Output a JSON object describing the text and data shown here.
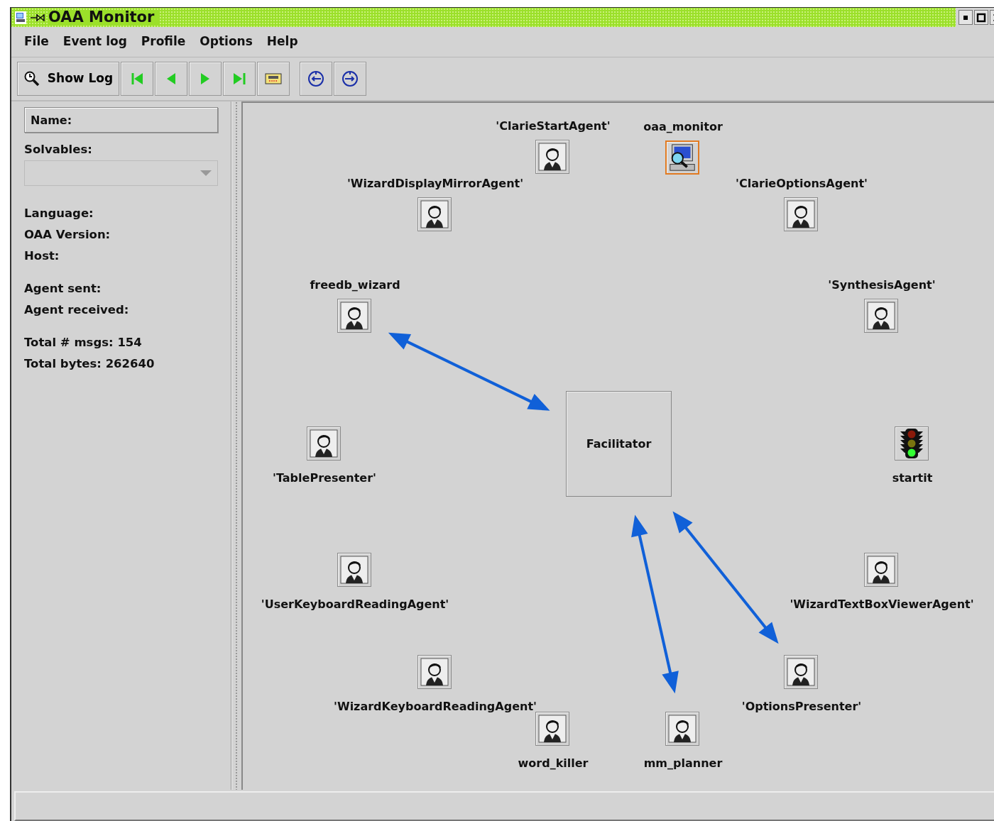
{
  "window": {
    "title": "OAA Monitor"
  },
  "menu": [
    "File",
    "Event log",
    "Profile",
    "Options",
    "Help"
  ],
  "toolbar": {
    "show_log": "Show Log"
  },
  "details": {
    "name_label": "Name:",
    "solvables_label": "Solvables:",
    "fields": [
      "Language:",
      "OAA Version:",
      "Host:"
    ],
    "agent_stats": [
      "Agent sent:",
      "Agent received:"
    ],
    "totals": [
      "Total # msgs: 154",
      "Total bytes: 262640"
    ]
  },
  "facilitator": {
    "label": "Facilitator"
  },
  "agents": [
    {
      "label": "'ClarieStartAgent'",
      "kind": "agent",
      "selected": false,
      "connected": false
    },
    {
      "label": "oaa_monitor",
      "kind": "monitor",
      "selected": true,
      "connected": false
    },
    {
      "label": "'WizardDisplayMirrorAgent'",
      "kind": "agent",
      "selected": false,
      "connected": false
    },
    {
      "label": "'ClarieOptionsAgent'",
      "kind": "agent",
      "selected": false,
      "connected": false
    },
    {
      "label": "freedb_wizard",
      "kind": "agent",
      "selected": false,
      "connected": true
    },
    {
      "label": "'SynthesisAgent'",
      "kind": "agent",
      "selected": false,
      "connected": false
    },
    {
      "label": "'TablePresenter'",
      "kind": "agent",
      "selected": false,
      "connected": false
    },
    {
      "label": "startit",
      "kind": "traffic-light",
      "selected": false,
      "connected": false
    },
    {
      "label": "'UserKeyboardReadingAgent'",
      "kind": "agent",
      "selected": false,
      "connected": false
    },
    {
      "label": "'WizardTextBoxViewerAgent'",
      "kind": "agent",
      "selected": false,
      "connected": false
    },
    {
      "label": "'WizardKeyboardReadingAgent'",
      "kind": "agent",
      "selected": false,
      "connected": false
    },
    {
      "label": "'OptionsPresenter'",
      "kind": "agent",
      "selected": false,
      "connected": true
    },
    {
      "label": "word_killer",
      "kind": "agent",
      "selected": false,
      "connected": false
    },
    {
      "label": "mm_planner",
      "kind": "agent",
      "selected": false,
      "connected": true
    }
  ]
}
